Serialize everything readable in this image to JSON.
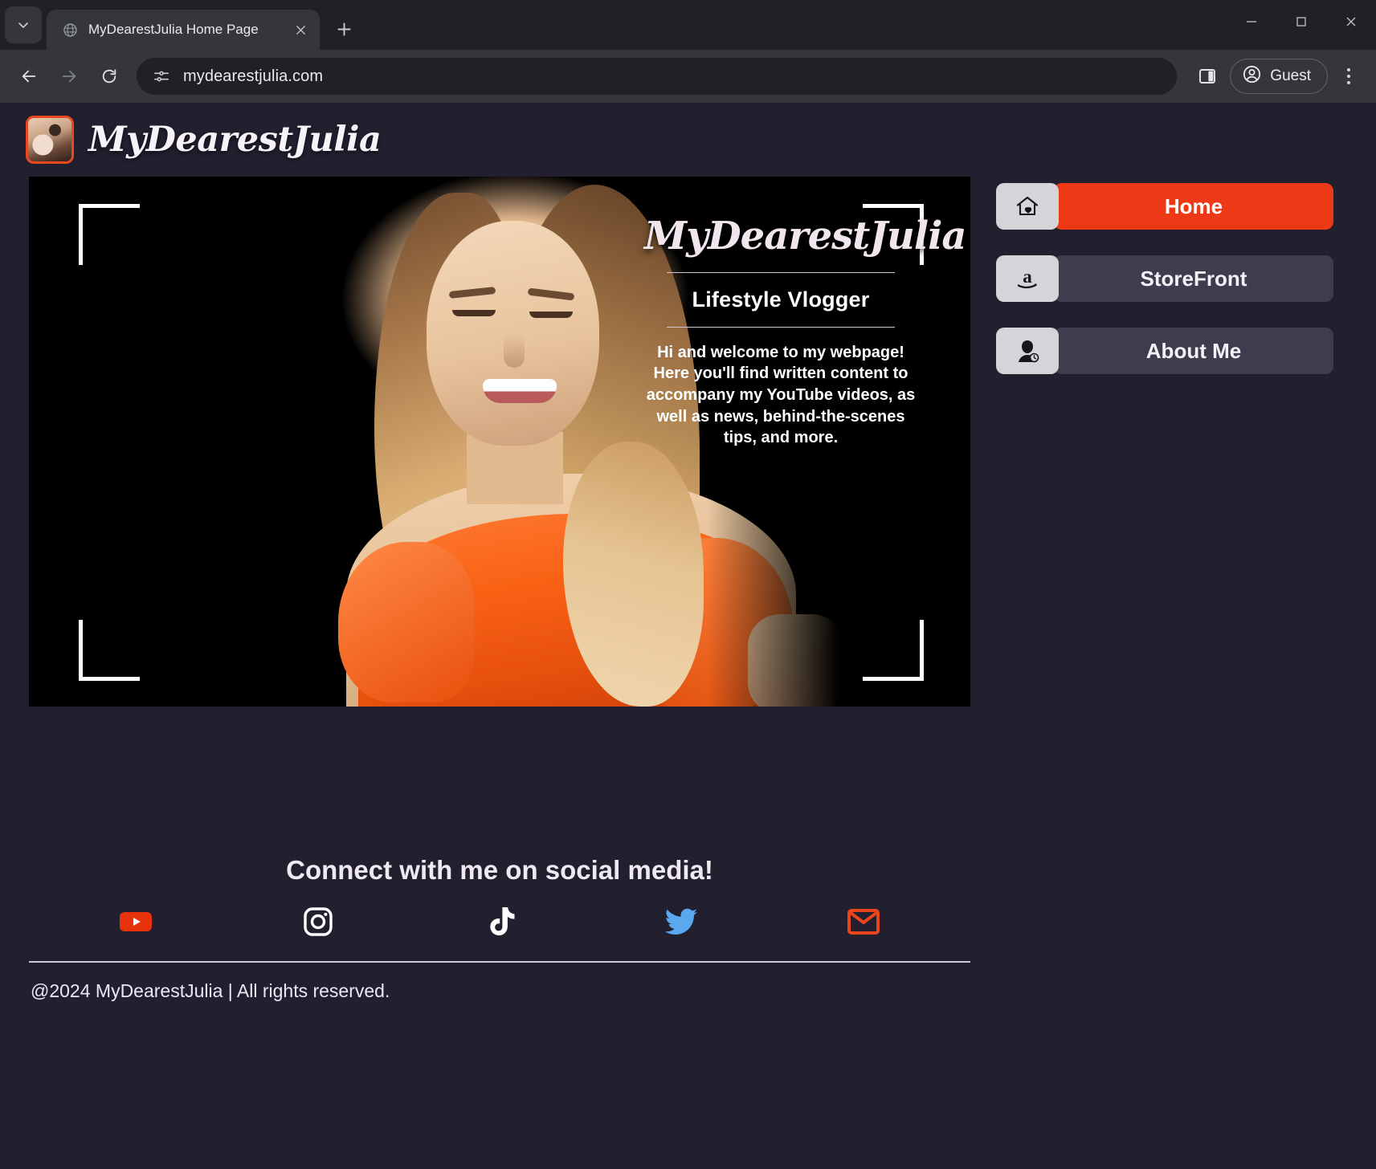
{
  "browser": {
    "tab": {
      "title": "MyDearestJulia Home Page",
      "favicon": "globe-icon"
    },
    "new_tab_label": "+",
    "address": "mydearestjulia.com",
    "profile_label": "Guest",
    "window_controls": {
      "minimize": "—",
      "maximize": "□",
      "close": "✕"
    }
  },
  "site": {
    "brand": "MyDearestJulia",
    "header_avatar": "julia-avatar"
  },
  "hero": {
    "brand": "MyDearestJulia",
    "role": "Lifestyle Vlogger",
    "body": "Hi and welcome to my webpage! Here you'll find written content to accompany my YouTube videos, as well as news, behind-the-scenes tips, and more."
  },
  "nav": {
    "items": [
      {
        "label": "Home",
        "icon": "home-heart-icon",
        "active": true,
        "accent": "#ed3915"
      },
      {
        "label": "StoreFront",
        "icon": "amazon-a-icon",
        "active": false
      },
      {
        "label": "About Me",
        "icon": "person-portrait-icon",
        "active": false
      }
    ]
  },
  "footer": {
    "title": "Connect with me on social media!",
    "socials": [
      {
        "name": "youtube-icon",
        "color": "#e8320c"
      },
      {
        "name": "instagram-icon",
        "color": "#ffffff"
      },
      {
        "name": "tiktok-icon",
        "color": "#ffffff"
      },
      {
        "name": "twitter-icon",
        "color": "#5aa9ee"
      },
      {
        "name": "email-icon",
        "color": "#e8451c"
      }
    ],
    "copyright": "@2024 MyDearestJulia  |  All rights reserved."
  },
  "colors": {
    "page_bg": "#221f2f",
    "accent": "#ed3915",
    "nav_inactive": "#403c4e",
    "nav_icon_bg": "#d6d4d9"
  }
}
